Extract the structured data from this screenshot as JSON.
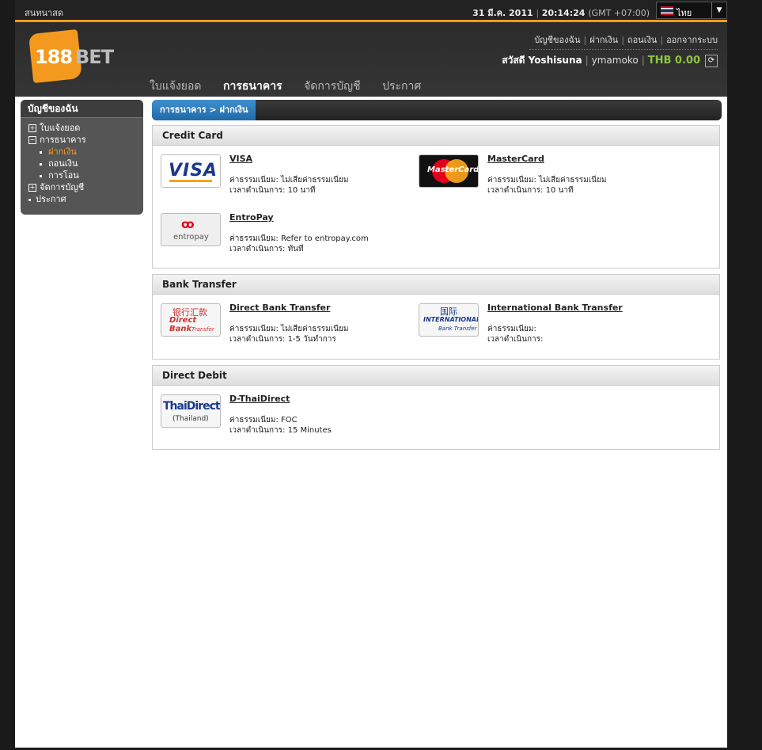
{
  "topbar": {
    "live_label": "สนทนาสด",
    "date": "31 มี.ค. 2011",
    "time": "20:14:24",
    "timezone": "(GMT +07:00)",
    "language": "ไทย"
  },
  "header": {
    "logo_number": "188",
    "logo_word": "BET",
    "links": [
      "บัญชีของฉัน",
      "ฝากเงิน",
      "ถอนเงิน",
      "ออกจากระบบ"
    ],
    "greeting": "สวัสดี Yoshisuna",
    "username": "ymamoko",
    "balance": "THB 0.00",
    "nav": [
      "ใบแจ้งยอด",
      "การธนาคาร",
      "จัดการบัญชี",
      "ประกาศ"
    ],
    "active_nav": "การธนาคาร"
  },
  "sidebar": {
    "title": "บัญชีของฉัน",
    "items": [
      {
        "label": "ใบแจ้งยอด",
        "marker": "+"
      },
      {
        "label": "การธนาคาร",
        "marker": "−"
      },
      {
        "label": "ฝากเงิน",
        "active": true
      },
      {
        "label": "ถอนเงิน"
      },
      {
        "label": "การโอน"
      },
      {
        "label": "จัดการบัญชี",
        "marker": "+"
      },
      {
        "label": "ประกาศ"
      }
    ]
  },
  "breadcrumb": "การธนาคาร > ฝากเงิน",
  "sections": {
    "credit_card": {
      "title": "Credit Card",
      "methods": [
        {
          "name": "VISA",
          "fee": "ค่าธรรมเนียม: ไม่เสียค่าธรรมเนียม",
          "time": "เวลาดำเนินการ: 10 นาที",
          "icon": "VISA"
        },
        {
          "name": "MasterCard",
          "fee": "ค่าธรรมเนียม: ไม่เสียค่าธรรมเนียม",
          "time": "เวลาดำเนินการ: 10 นาที",
          "icon": "MasterCard"
        },
        {
          "name": "EntroPay",
          "fee": "ค่าธรรมเนียม: Refer to entropay.com",
          "time": "เวลาดำเนินการ: ทันที",
          "icon": "entropay"
        }
      ]
    },
    "bank_transfer": {
      "title": "Bank Transfer",
      "methods": [
        {
          "name": "Direct Bank Transfer",
          "fee": "ค่าธรรมเนียม: ไม่เสียค่าธรรมเนียม",
          "time": "เวลาดำเนินการ: 1-5 วันทำการ",
          "icon_cn": "银行汇款",
          "icon_en": "Direct Bank",
          "icon_sub": "Transfer"
        },
        {
          "name": "International Bank Transfer",
          "fee": "ค่าธรรมเนียม:",
          "time": "เวลาดำเนินการ:",
          "icon_cn": "国际",
          "icon_en": "INTERNATIONAL",
          "icon_sub": "Bank Transfer"
        }
      ]
    },
    "direct_debit": {
      "title": "Direct Debit",
      "methods": [
        {
          "name": "D-ThaiDirect",
          "fee": "ค่าธรรมเนียม: FOC",
          "time": "เวลาดำเนินการ: 15 Minutes",
          "icon_en": "ThaiDirect",
          "icon_sub": "(Thailand)"
        }
      ]
    }
  }
}
